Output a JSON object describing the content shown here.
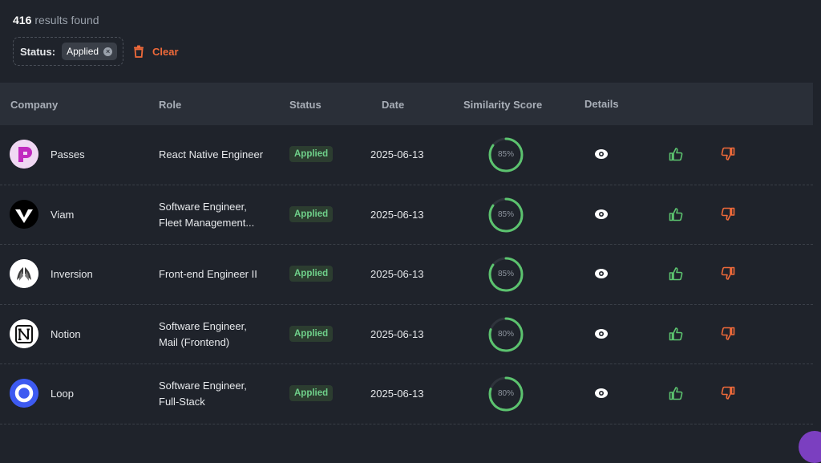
{
  "summary": {
    "count": "416",
    "text": "results found"
  },
  "filters": {
    "label": "Status:",
    "chip": "Applied",
    "clear_label": "Clear"
  },
  "columns": [
    "Company",
    "Role",
    "Status",
    "Date",
    "Similarity Score",
    "Details"
  ],
  "rows": [
    {
      "company": "Passes",
      "role_line1": "React Native Engineer",
      "role_line2": "",
      "status": "Applied",
      "date": "2025-06-13",
      "score": "85%",
      "score_value": 0.85
    },
    {
      "company": "Viam",
      "role_line1": "Software Engineer,",
      "role_line2": "Fleet Management...",
      "status": "Applied",
      "date": "2025-06-13",
      "score": "85%",
      "score_value": 0.85
    },
    {
      "company": "Inversion",
      "role_line1": "Front-end Engineer II",
      "role_line2": "",
      "status": "Applied",
      "date": "2025-06-13",
      "score": "85%",
      "score_value": 0.85
    },
    {
      "company": "Notion",
      "role_line1": "Software Engineer,",
      "role_line2": "Mail (Frontend)",
      "status": "Applied",
      "date": "2025-06-13",
      "score": "80%",
      "score_value": 0.8
    },
    {
      "company": "Loop",
      "role_line1": "Software Engineer,",
      "role_line2": "Full-Stack",
      "status": "Applied",
      "date": "2025-06-13",
      "score": "80%",
      "score_value": 0.8
    }
  ],
  "colors": {
    "accent_green": "#5cc36f",
    "accent_orange": "#ef6a3a",
    "badge_bg": "#2c3d30"
  },
  "icons": {
    "clear": "trash-icon",
    "details": "eye-icon",
    "like": "thumbs-up-icon",
    "dislike": "thumbs-down-icon"
  }
}
